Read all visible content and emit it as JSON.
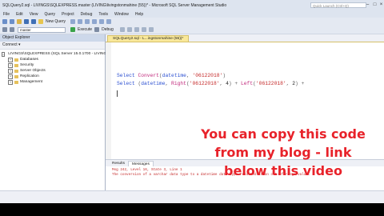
{
  "window": {
    "title": "SQLQuery2.sql - LIVINGS\\SQLEXPRESS.master (LIVING\\livingstonmahine (55))* - Microsoft SQL Server Management Studio",
    "quick_launch_placeholder": "Quick Launch (Ctrl+Q)"
  },
  "menu": [
    "File",
    "Edit",
    "View",
    "Query",
    "Project",
    "Debug",
    "Tools",
    "Window",
    "Help"
  ],
  "toolbar": {
    "new_query_label": "New Query",
    "database": "master",
    "execute_label": "Execute",
    "debug_label": "Debug"
  },
  "object_explorer": {
    "title": "Object Explorer",
    "connect_label": "Connect ▾",
    "server": "LIVINGS\\SQLEXPRESS (SQL Server 15.0.1700 - LIVING\\",
    "nodes": [
      "Databases",
      "Security",
      "Server Objects",
      "Replication",
      "Management"
    ]
  },
  "editor": {
    "tab_label": "SQLQuery2.sql - L...ingstonmahine (55))*",
    "line1": {
      "k1": "Select",
      "f1": "Convert",
      "open": "(",
      "k2": "datetime",
      "comma": ", ",
      "s1": "'06122018'",
      "close": ")"
    },
    "line2": {
      "k1": "Select",
      "open": " (",
      "k2": "datetime",
      "comma1": ", ",
      "f1": "Right",
      "open2": "(",
      "s1": "'06122018'",
      "comma2": ", ",
      "n1": "4",
      "close2": ")",
      "plus": " + ",
      "f2": "Left",
      "open3": "(",
      "s2": "'06122018'",
      "comma3": ", ",
      "n2": "2",
      "close3": ")",
      "tail": " +"
    }
  },
  "results": {
    "tabs": [
      "Results",
      "Messages"
    ],
    "message_line1": "Msg 242, Level 16, State 3, Line 1",
    "message_line2": "The conversion of a varchar data type to a datetime data type resulted in an out-of-range value."
  },
  "overlay": {
    "line1": "You can copy this code",
    "line2": "from my blog - link",
    "line3": "below this video"
  },
  "colors": {
    "overlay_text": "#e8222a",
    "keyword": "#2b4fd1",
    "string": "#c42828",
    "function": "#c0287b"
  }
}
